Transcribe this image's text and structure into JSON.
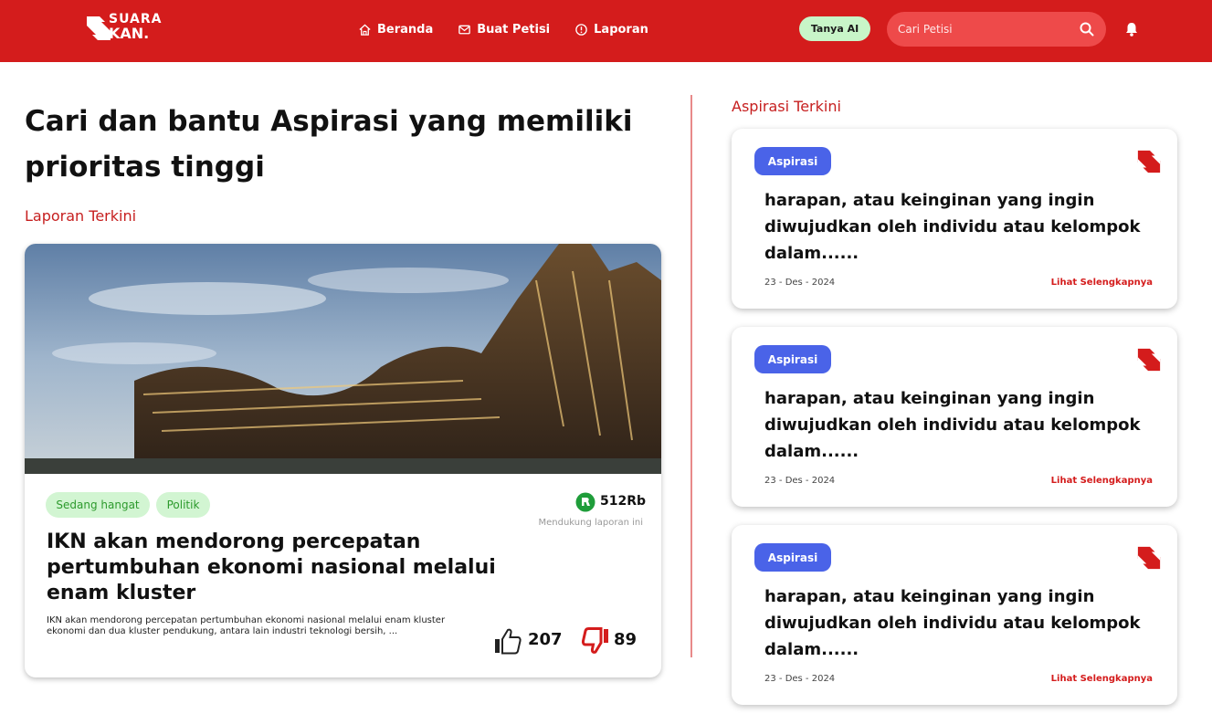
{
  "header": {
    "logo_line1": "SUARA",
    "logo_line2": "KAN.",
    "nav": [
      {
        "label": "Beranda",
        "icon": "home-icon"
      },
      {
        "label": "Buat Petisi",
        "icon": "mail-icon"
      },
      {
        "label": "Laporan",
        "icon": "alert-circle-icon"
      }
    ],
    "ai_button": "Tanya AI",
    "search_placeholder": "Cari Petisi",
    "colors": {
      "brand": "#d41c1c",
      "ai_pill": "#c8f5c8",
      "search_bg": "#ee4a4a"
    }
  },
  "main": {
    "headline": "Cari dan bantu Aspirasi yang memiliki prioritas tinggi",
    "latest_reports_label": "Laporan Terkini",
    "report": {
      "tags": [
        "Sedang hangat",
        "Politik"
      ],
      "support_count": "512Rb",
      "support_text": "Mendukung laporan ini",
      "title": "IKN akan mendorong percepatan pertumbuhan ekonomi nasional melalui enam kluster",
      "description": "IKN akan mendorong percepatan pertumbuhan ekonomi nasional melalui enam kluster ekonomi dan dua kluster pendukung, antara lain industri teknologi bersih, ...",
      "likes": "207",
      "dislikes": "89"
    }
  },
  "sidebar": {
    "label": "Aspirasi Terkini",
    "cards": [
      {
        "badge": "Aspirasi",
        "text": "harapan, atau keinginan yang ingin diwujudkan oleh individu atau kelompok dalam......",
        "date": "23 - Des - 2024",
        "more": "Lihat Selengkapnya"
      },
      {
        "badge": "Aspirasi",
        "text": "harapan, atau keinginan yang ingin diwujudkan oleh individu atau kelompok dalam......",
        "date": "23 - Des - 2024",
        "more": "Lihat Selengkapnya"
      },
      {
        "badge": "Aspirasi",
        "text": "harapan, atau keinginan yang ingin diwujudkan oleh individu atau kelompok dalam......",
        "date": "23 - Des - 2024",
        "more": "Lihat Selengkapnya"
      }
    ],
    "colors": {
      "badge": "#4a63e8",
      "link": "#d41c1c"
    }
  }
}
